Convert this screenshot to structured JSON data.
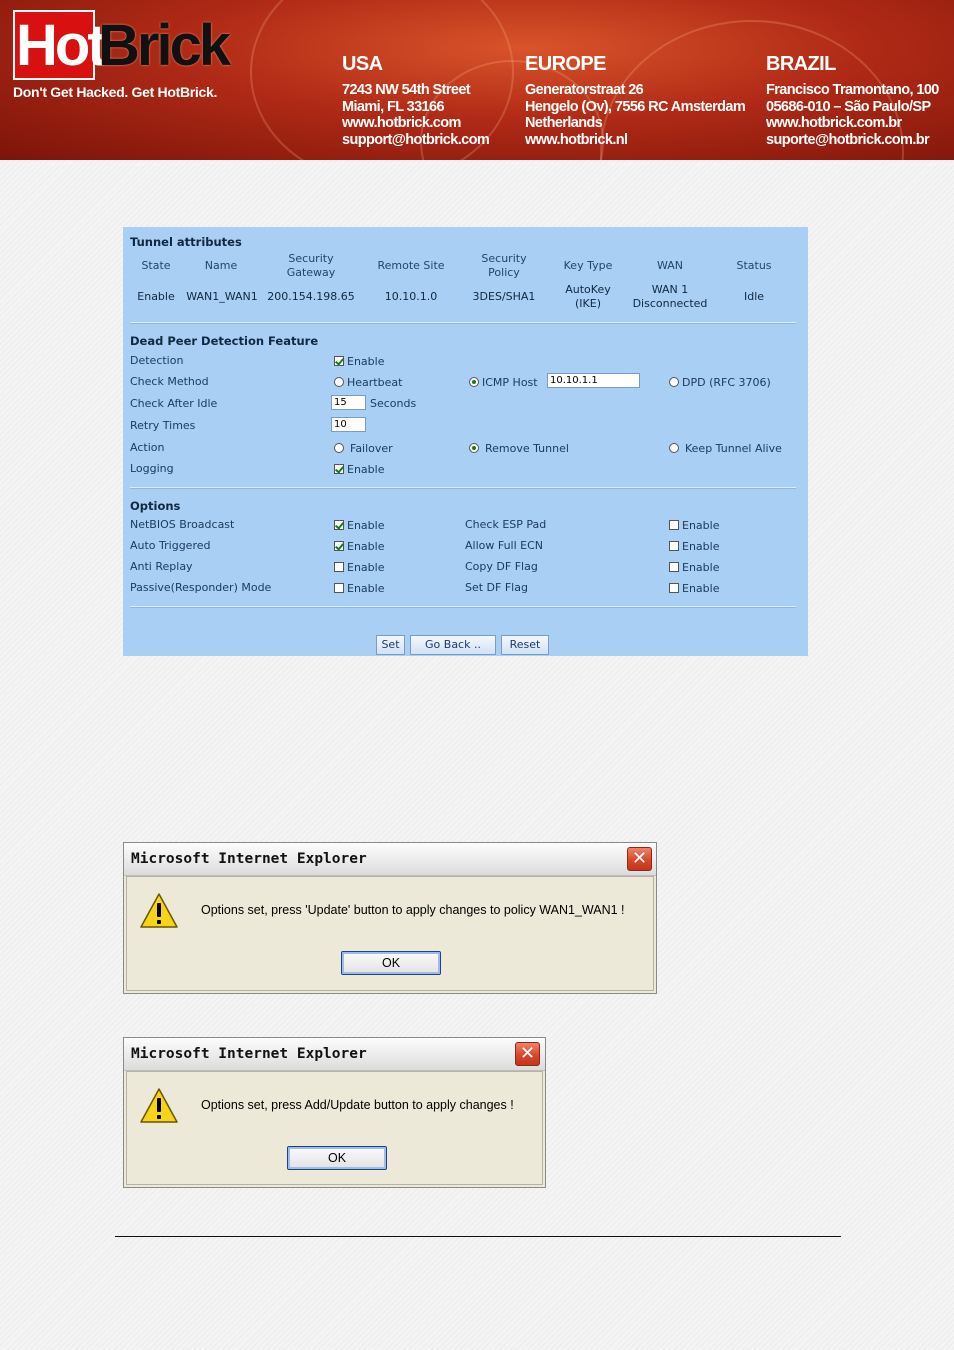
{
  "banner": {
    "logo": {
      "hot": "Hot",
      "brick": "Brick"
    },
    "tagline": "Don't Get Hacked. Get HotBrick.",
    "regions": [
      {
        "title": "USA",
        "lines": [
          "7243 NW 54th Street",
          "Miami, FL 33166",
          "www.hotbrick.com",
          "support@hotbrick.com"
        ]
      },
      {
        "title": "EUROPE",
        "lines": [
          "Generatorstraat 26",
          "Hengelo (Ov), 7556 RC Amsterdam",
          "Netherlands",
          "www.hotbrick.nl"
        ]
      },
      {
        "title": "BRAZIL",
        "lines": [
          "Francisco Tramontano, 100",
          "05686-010 – São Paulo/SP",
          "www.hotbrick.com.br",
          "suporte@hotbrick.com.br"
        ]
      }
    ]
  },
  "tunnel": {
    "title": "Tunnel attributes",
    "headers": {
      "state": "State",
      "name": "Name",
      "gateway_1": "Security",
      "gateway_2": "Gateway",
      "remote_site": "Remote Site",
      "policy_1": "Security",
      "policy_2": "Policy",
      "key_type": "Key Type",
      "wan": "WAN",
      "status": "Status"
    },
    "row": {
      "state": "Enable",
      "name": "WAN1_WAN1",
      "gateway": "200.154.198.65",
      "remote_site": "10.10.1.0",
      "policy": "3DES/SHA1",
      "key_type_1": "AutoKey",
      "key_type_2": "(IKE)",
      "wan_1": "WAN 1",
      "wan_2": "Disconnected",
      "status": "Idle"
    }
  },
  "dpd": {
    "title": "Dead Peer Detection Feature",
    "detection": {
      "label": "Detection",
      "option": "Enable",
      "checked": true
    },
    "check_method": {
      "label": "Check Method",
      "options": [
        "Heartbeat",
        "ICMP Host",
        "DPD (RFC 3706)"
      ],
      "selected": "ICMP Host",
      "icmp_host_value": "10.10.1.1"
    },
    "check_after_idle": {
      "label": "Check After Idle",
      "value": "15",
      "unit": "Seconds"
    },
    "retry_times": {
      "label": "Retry Times",
      "value": "10"
    },
    "action": {
      "label": "Action",
      "options": [
        "Failover",
        "Remove Tunnel",
        "Keep Tunnel Alive"
      ],
      "selected": "Remove Tunnel"
    },
    "logging": {
      "label": "Logging",
      "option": "Enable",
      "checked": true
    }
  },
  "options": {
    "title": "Options",
    "left": [
      {
        "label": "NetBIOS Broadcast",
        "option": "Enable",
        "checked": true
      },
      {
        "label": "Auto Triggered",
        "option": "Enable",
        "checked": true
      },
      {
        "label": "Anti Replay",
        "option": "Enable",
        "checked": false
      },
      {
        "label": "Passive(Responder) Mode",
        "option": "Enable",
        "checked": false
      }
    ],
    "right": [
      {
        "label": "Check ESP Pad",
        "option": "Enable",
        "checked": false
      },
      {
        "label": "Allow Full ECN",
        "option": "Enable",
        "checked": false
      },
      {
        "label": "Copy DF Flag",
        "option": "Enable",
        "checked": false
      },
      {
        "label": "Set DF Flag",
        "option": "Enable",
        "checked": false
      }
    ]
  },
  "buttons": {
    "set": "Set",
    "go_back": "Go Back ..",
    "reset": "Reset"
  },
  "dialog1": {
    "title": "Microsoft Internet Explorer",
    "message": "Options set, press 'Update' button to apply changes to policy WAN1_WAN1 !",
    "ok": "OK"
  },
  "dialog2": {
    "title": "Microsoft Internet Explorer",
    "message": "Options set, press Add/Update button to apply changes !",
    "ok": "OK"
  }
}
